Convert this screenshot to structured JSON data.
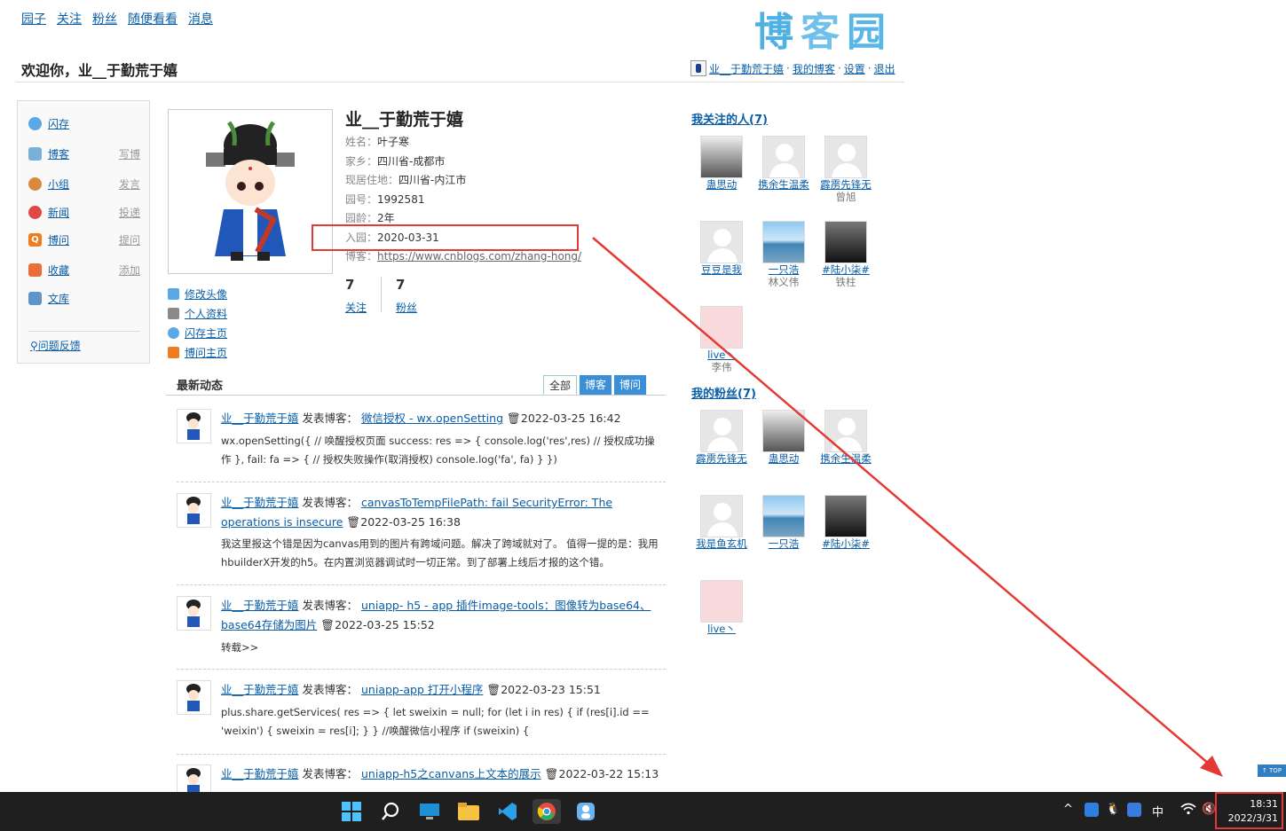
{
  "nav": [
    "园子",
    "关注",
    "粉丝",
    "随便看看",
    "消息"
  ],
  "logo": [
    "博",
    "客",
    "园"
  ],
  "welcome": "欢迎你，业__于勤荒于嬉",
  "userbar": {
    "name": "业__于勤荒于嬉",
    "sep1": "·",
    "my_blog": "我的博客",
    "sep2": "·",
    "settings": "设置",
    "sep3": "·",
    "logout": "退出"
  },
  "sidebar": [
    {
      "label": "闪存",
      "sub": "",
      "icon": "chat-icon",
      "color": "#5aa9e6"
    },
    {
      "label": "博客",
      "sub": "写博",
      "icon": "pen-icon",
      "color": "#7ab0d8"
    },
    {
      "label": "小组",
      "sub": "发言",
      "icon": "group-icon",
      "color": "#d88a3c"
    },
    {
      "label": "新闻",
      "sub": "投递",
      "icon": "news-icon",
      "color": "#e04848"
    },
    {
      "label": "博问",
      "sub": "提问",
      "icon": "q-icon",
      "color": "#f07c1e"
    },
    {
      "label": "收藏",
      "sub": "添加",
      "icon": "star-icon",
      "color": "#e86f3a"
    },
    {
      "label": "文库",
      "sub": "",
      "icon": "book-icon",
      "color": "#5f95c8"
    }
  ],
  "feedback": "问题反馈",
  "avatar_links": [
    {
      "label": "修改头像",
      "icon": "avatar-edit-icon",
      "color": "#5aa9e6"
    },
    {
      "label": "个人资料",
      "icon": "card-icon",
      "color": "#8a8a8a"
    },
    {
      "label": "闪存主页",
      "icon": "chat-icon",
      "color": "#5aa9e6"
    },
    {
      "label": "博问主页",
      "icon": "q-icon",
      "color": "#f07c1e"
    }
  ],
  "profile": {
    "name": "业__于勤荒于嬉",
    "rows": [
      {
        "k": "姓名：",
        "v": "叶子寒"
      },
      {
        "k": "家乡：",
        "v": "四川省-成都市"
      },
      {
        "k": "现居住地：",
        "v": "四川省-内江市"
      },
      {
        "k": "园号：",
        "v": "1992581"
      },
      {
        "k": "园龄：",
        "v": "2年"
      },
      {
        "k": "入园：",
        "v": "2020-03-31"
      }
    ],
    "blog_key": "博客：",
    "blog_url": "https://www.cnblogs.com/zhang-hong/",
    "following_count": "7",
    "following_label": "关注",
    "followers_count": "7",
    "followers_label": "粉丝"
  },
  "feed": {
    "title": "最新动态",
    "tabs": [
      "全部",
      "博客",
      "博问"
    ],
    "entries": [
      {
        "user": "业__于勤荒于嬉",
        "action": "发表博客：",
        "title": "微信授权 - wx.openSetting",
        "date": "2022-03-25 16:42",
        "body": "wx.openSetting({ // 唤醒授权页面 success: res => { console.log('res',res) // 授权成功操作 }, fail: fa => { // 授权失败操作(取消授权) console.log('fa', fa) } })"
      },
      {
        "user": "业__于勤荒于嬉",
        "action": "发表博客：",
        "title": "canvasToTempFilePath: fail SecurityError: The operations is insecure",
        "date": "2022-03-25 16:38",
        "body": "我这里报这个错是因为canvas用到的图片有跨域问题。解决了跨域就对了。 值得一提的是：我用hbuilderX开发的h5。在内置浏览器调试时一切正常。到了部署上线后才报的这个错。"
      },
      {
        "user": "业__于勤荒于嬉",
        "action": "发表博客：",
        "title": "uniapp- h5 - app 插件image-tools：图像转为base64、base64存储为图片",
        "date": "2022-03-25 15:52",
        "body": "转载>>"
      },
      {
        "user": "业__于勤荒于嬉",
        "action": "发表博客：",
        "title": "uniapp-app 打开小程序",
        "date": "2022-03-23 15:51",
        "body": "plus.share.getServices( res => { let sweixin = null; for (let i in res) { if (res[i].id == 'weixin') { sweixin = res[i]; } } //唤醒微信小程序 if (sweixin) {"
      },
      {
        "user": "业__于勤荒于嬉",
        "action": "发表博客：",
        "title": "uniapp-h5之canvans上文本的展示",
        "date": "2022-03-22 15:13",
        "body": ""
      }
    ]
  },
  "following": {
    "title": "我关注的人(7)",
    "people": [
      {
        "name": "蛊思动",
        "sub": "",
        "pic": "photo"
      },
      {
        "name": "携余生温柔",
        "sub": "",
        "pic": "gray"
      },
      {
        "name": "霹雳先锋无",
        "sub": "曾旭",
        "pic": "gray"
      },
      {
        "name": "豆豆是我",
        "sub": "",
        "pic": "gray"
      },
      {
        "name": "一只浩",
        "sub": "林义伟",
        "pic": "sea"
      },
      {
        "name": "#陆小柒#",
        "sub": "铁柱",
        "pic": "dark"
      },
      {
        "name": "live丶",
        "sub": "李伟",
        "pic": "pig"
      }
    ]
  },
  "followers": {
    "title": "我的粉丝(7)",
    "people": [
      {
        "name": "霹雳先锋无",
        "sub": "",
        "pic": "gray"
      },
      {
        "name": "蛊思动",
        "sub": "",
        "pic": "photo"
      },
      {
        "name": "携余生温柔",
        "sub": "",
        "pic": "gray"
      },
      {
        "name": "我是鱼玄机",
        "sub": "",
        "pic": "gray"
      },
      {
        "name": "一只浩",
        "sub": "",
        "pic": "sea"
      },
      {
        "name": "#陆小柒#",
        "sub": "",
        "pic": "dark"
      },
      {
        "name": "live丶",
        "sub": "",
        "pic": "pig"
      }
    ]
  },
  "top_button": "↑ TOP",
  "taskbar": {
    "ime": "中",
    "time": "18:31",
    "date": "2022/3/31"
  }
}
